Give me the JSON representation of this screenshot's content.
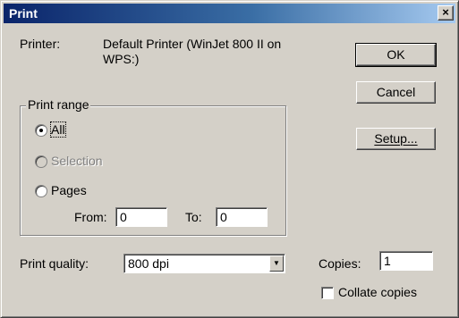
{
  "window": {
    "title": "Print",
    "close_glyph": "×"
  },
  "printer": {
    "label": "Printer:",
    "name_line1": "Default Printer (WinJet 800 II on",
    "name_line2": "WPS:)"
  },
  "buttons": {
    "ok": "OK",
    "cancel": "Cancel",
    "setup": "Setup..."
  },
  "print_range": {
    "label": "Print range",
    "all": "All",
    "selection": "Selection",
    "pages": "Pages",
    "selected": "all",
    "from_label": "From:",
    "from_value": "0",
    "to_label": "To:",
    "to_value": "0"
  },
  "quality": {
    "label": "Print quality:",
    "value": "800 dpi"
  },
  "copies": {
    "label": "Copies:",
    "value": "1"
  },
  "collate": {
    "label": "Collate copies",
    "checked": false
  },
  "icons": {
    "dropdown": "chevron-down-icon",
    "close": "close-icon"
  }
}
